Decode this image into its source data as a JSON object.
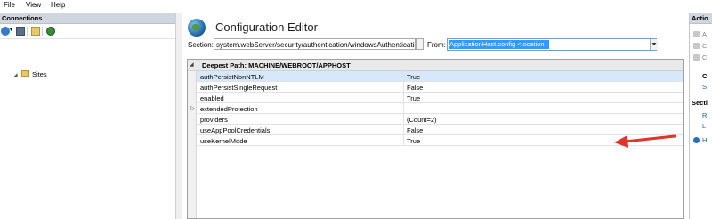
{
  "menu": {
    "file": "File",
    "view": "View",
    "help": "Help"
  },
  "connections": {
    "title": "Connections",
    "tree": {
      "sites_label": "Sites"
    }
  },
  "editor": {
    "title": "Configuration Editor",
    "section_label": "Section:",
    "section_value": "system.webServer/security/authentication/windowsAuthenticatio",
    "from_label": "From:",
    "from_value": "ApplicationHost.config <location",
    "deepest_path": "Deepest Path: MACHINE/WEBROOT/APPHOST",
    "rows": [
      {
        "name": "authPersistNonNTLM",
        "value": "True"
      },
      {
        "name": "authPersistSingleRequest",
        "value": "False"
      },
      {
        "name": "enabled",
        "value": "True"
      },
      {
        "name": "extendedProtection",
        "value": ""
      },
      {
        "name": "providers",
        "value": "(Count=2)"
      },
      {
        "name": "useAppPoolCredentials",
        "value": "False"
      },
      {
        "name": "useKernelMode",
        "value": "True"
      }
    ]
  },
  "actions": {
    "title": "Actio",
    "items": [
      "A",
      "C",
      "C",
      "S",
      "Secti",
      "R",
      "L",
      "H"
    ]
  },
  "colors": {
    "selection": "#3399ff",
    "arrow": "#e0342c",
    "header": "#cfd6df"
  }
}
